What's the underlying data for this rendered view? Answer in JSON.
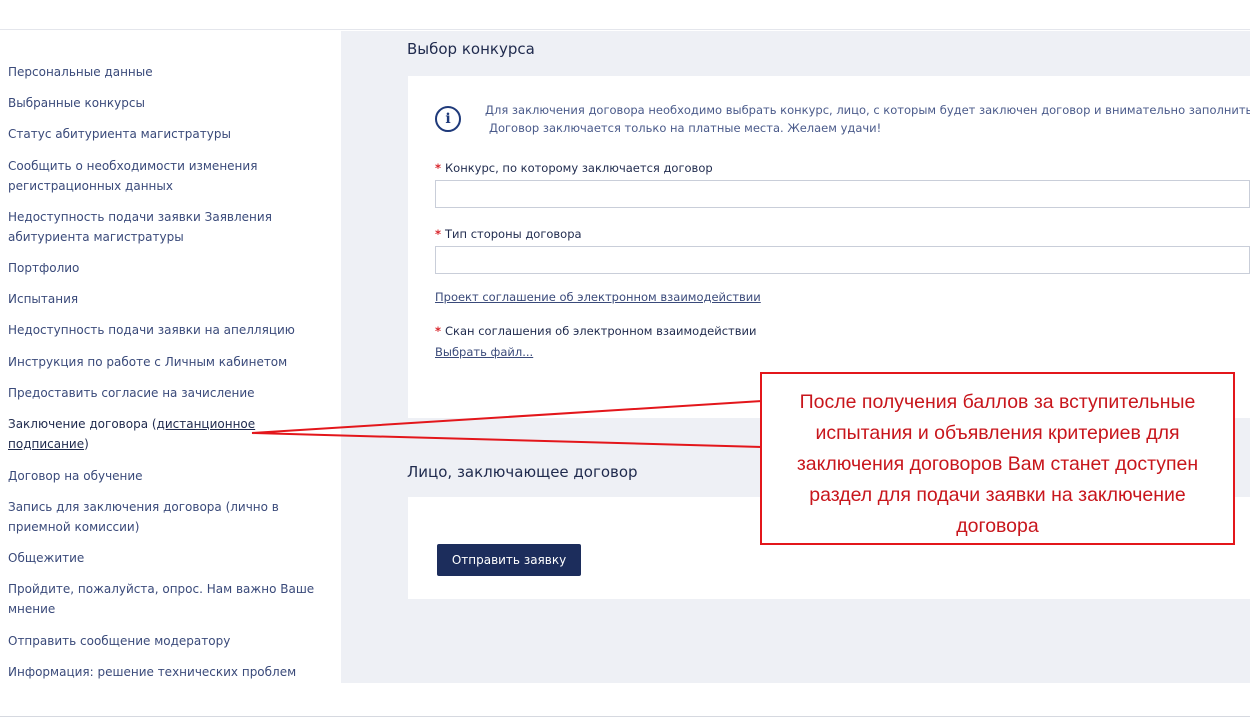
{
  "sidebar": {
    "items": [
      {
        "label": "Персональные данные"
      },
      {
        "label": "Выбранные конкурсы"
      },
      {
        "label": "Статус абитуриента магистратуры"
      },
      {
        "label": "Сообщить о необходимости изменения",
        "label2": "регистрационных данных"
      },
      {
        "label": "Недоступность подачи заявки Заявления",
        "label2": "абитуриента магистратуры"
      },
      {
        "label": "Портфолио"
      },
      {
        "label": "Испытания"
      },
      {
        "label": "Недоступность подачи заявки на апелляцию"
      },
      {
        "label": "Инструкция по работе с Личным кабинетом"
      },
      {
        "label": "Предоставить согласие на зачисление"
      },
      {
        "label_a": "Заключение договора (",
        "label_b": "дистанционное",
        "label_c": "подписание",
        "label_d": ")"
      },
      {
        "label": "Договор на обучение"
      },
      {
        "label": "Запись для заключения договора (лично в",
        "label2": "приемной комиссии)"
      },
      {
        "label": "Общежитие"
      },
      {
        "label": "Пройдите, пожалуйста, опрос. Нам важно Ваше",
        "label2": "мнение"
      },
      {
        "label": "Отправить сообщение модератору"
      },
      {
        "label": "Информация: решение технических проблем"
      }
    ]
  },
  "contest_section": {
    "title": "Выбор конкурса",
    "info_icon": "info-circle-icon",
    "info_line1": "Для заключения договора необходимо выбрать конкурс, лицо, с которым будет заключен договор и внимательно заполнить за",
    "info_line2": "Договор заключается только на платные места. Желаем удачи!",
    "required_mark": "*",
    "field_contest_label": "Конкурс, по которому заключается договор",
    "field_contest_value": "",
    "field_party_label": "Тип стороны договора",
    "field_party_value": "",
    "agreement_link": "Проект соглашение об электронном взаимодействии",
    "scan_label": "Скан соглашения об электронном взаимодействии",
    "choose_file_link": "Выбрать файл..."
  },
  "person_section": {
    "title": "Лицо, заключающее договор",
    "submit_label": "Отправить заявку"
  },
  "callout": {
    "lines": [
      "После получения баллов за вступительные",
      "испытания и объявления критериев для",
      "заключения договоров Вам станет доступен",
      "раздел для подачи заявки на заключение",
      "договора"
    ],
    "color": "#e3161b"
  },
  "colors": {
    "accent": "#1c2d5c",
    "required": "#d9262c",
    "background_main": "#eef0f5"
  }
}
